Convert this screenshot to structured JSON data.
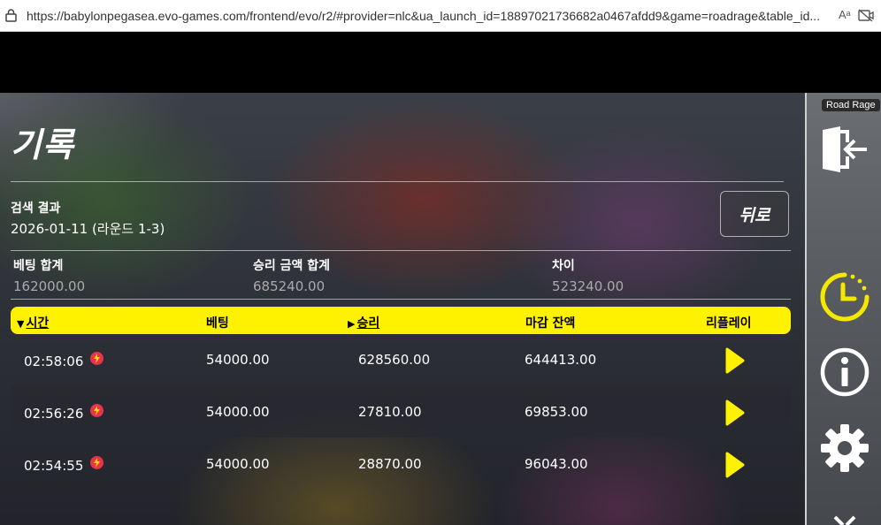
{
  "browser": {
    "url": "https://babylonpegasea.evo-games.com/frontend/evo/r2/#provider=nlc&ua_launch_id=18897021736682a0467afdd9&game=roadrage&table_id...",
    "read_aloud_label": "Aᵃ"
  },
  "history": {
    "title": "기록",
    "search_label": "검색 결과",
    "search_value": "2026-01-11 (라운드 1-3)",
    "back_label": "뒤로",
    "summary": [
      {
        "label": "베팅 합계",
        "value": "162000.00"
      },
      {
        "label": "승리 금액 합계",
        "value": "685240.00"
      },
      {
        "label": "차이",
        "value": "523240.00"
      }
    ],
    "columns": {
      "time": "시간",
      "bet": "베팅",
      "win": "승리",
      "balance": "마감 잔액",
      "replay": "리플레이"
    },
    "rows": [
      {
        "time": "02:58:06",
        "bet": "54000.00",
        "win": "628560.00",
        "balance": "644413.00"
      },
      {
        "time": "02:56:26",
        "bet": "54000.00",
        "win": "27810.00",
        "balance": "69853.00"
      },
      {
        "time": "02:54:55",
        "bet": "54000.00",
        "win": "28870.00",
        "balance": "96043.00"
      }
    ]
  },
  "sidebar": {
    "game_name": "Road Rage",
    "icons": [
      "exit-icon",
      "history-clock-icon",
      "info-icon",
      "settings-gear-icon",
      "close-icon"
    ]
  },
  "colors": {
    "accent": "#fff200",
    "lightning_badge": "#e8334f",
    "history_icon": "#f5e800"
  }
}
